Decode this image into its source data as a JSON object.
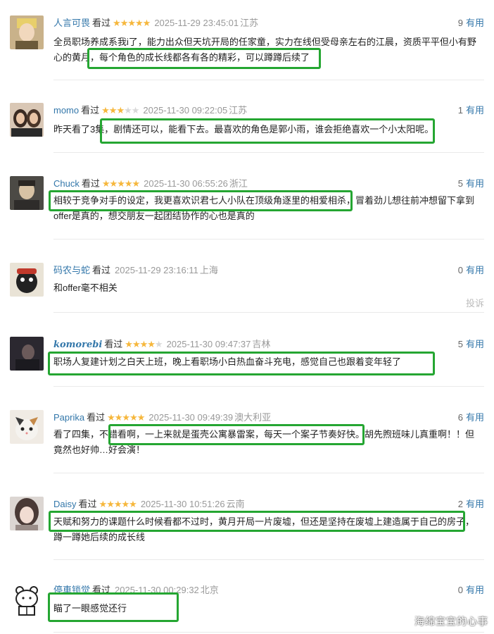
{
  "reviews": [
    {
      "username": "人言可畏",
      "watched": "看过",
      "rating": 5,
      "time": "2025-11-29 23:45:01",
      "location": "江苏",
      "useful_count": "9",
      "useful_label": "有用",
      "content": "全员职场养成系我i了，能力出众但天坑开局的任家童，实力在线但受母亲左右的江晨，资质平平但小有野心的黄月，每个角色的成长线都各有各的精彩，可以蹲蹲后续了"
    },
    {
      "username": "momo",
      "watched": "看过",
      "rating": 3,
      "time": "2025-11-30 09:22:05",
      "location": "江苏",
      "useful_count": "1",
      "useful_label": "有用",
      "content": "昨天看了3集，剧情还可以，能看下去。最喜欢的角色是郭小雨，谁会拒绝喜欢一个小太阳呢。"
    },
    {
      "username": "Chuck",
      "watched": "看过",
      "rating": 5,
      "time": "2025-11-30 06:55:26",
      "location": "浙江",
      "useful_count": "5",
      "useful_label": "有用",
      "content": "相较于竞争对手的设定，我更喜欢识君七人小队在顶级角逐里的相爱相杀，冒着劲儿想往前冲想留下拿到offer是真的，想交朋友一起团结协作的心也是真的"
    },
    {
      "username": "码农与蛇",
      "watched": "看过",
      "rating": 0,
      "time": "2025-11-29 23:16:11",
      "location": "上海",
      "useful_count": "0",
      "useful_label": "有用",
      "content": "和offer毫不相关"
    },
    {
      "username": "komorebi",
      "watched": "看过",
      "rating": 4,
      "time": "2025-11-30 09:47:37",
      "location": "吉林",
      "useful_count": "5",
      "useful_label": "有用",
      "content": "职场人复建计划之白天上班，晚上看职场小白热血奋斗充电，感觉自己也跟着变年轻了"
    },
    {
      "username": "Paprika",
      "watched": "看过",
      "rating": 5,
      "time": "2025-11-30 09:49:39",
      "location": "澳大利亚",
      "useful_count": "6",
      "useful_label": "有用",
      "content": "看了四集，不错看啊，一上来就是蛋壳公寓暴雷案，每天一个案子节奏好快。胡先煦班味儿真重啊！！但竟然也好帅…好会演！"
    },
    {
      "username": "Daisy",
      "watched": "看过",
      "rating": 5,
      "time": "2025-11-30 10:51:26",
      "location": "云南",
      "useful_count": "2",
      "useful_label": "有用",
      "content": "天赋和努力的课题什么时候看都不过时，黄月开局一片废墟，但还是坚持在废墟上建造属于自己的房子，蹲一蹲她后续的成长线"
    },
    {
      "username": "停車锁觉",
      "watched": "看过",
      "rating": 0,
      "time": "2025-11-30 00:29:32",
      "location": "北京",
      "useful_count": "0",
      "useful_label": "有用",
      "content": "瞄了一眼感觉还行"
    }
  ],
  "report_label": "投诉",
  "watermark": "海绵宝宝的心事",
  "colors": {
    "link": "#3377aa",
    "star": "#f6b73c",
    "highlight_box": "#25a632"
  }
}
